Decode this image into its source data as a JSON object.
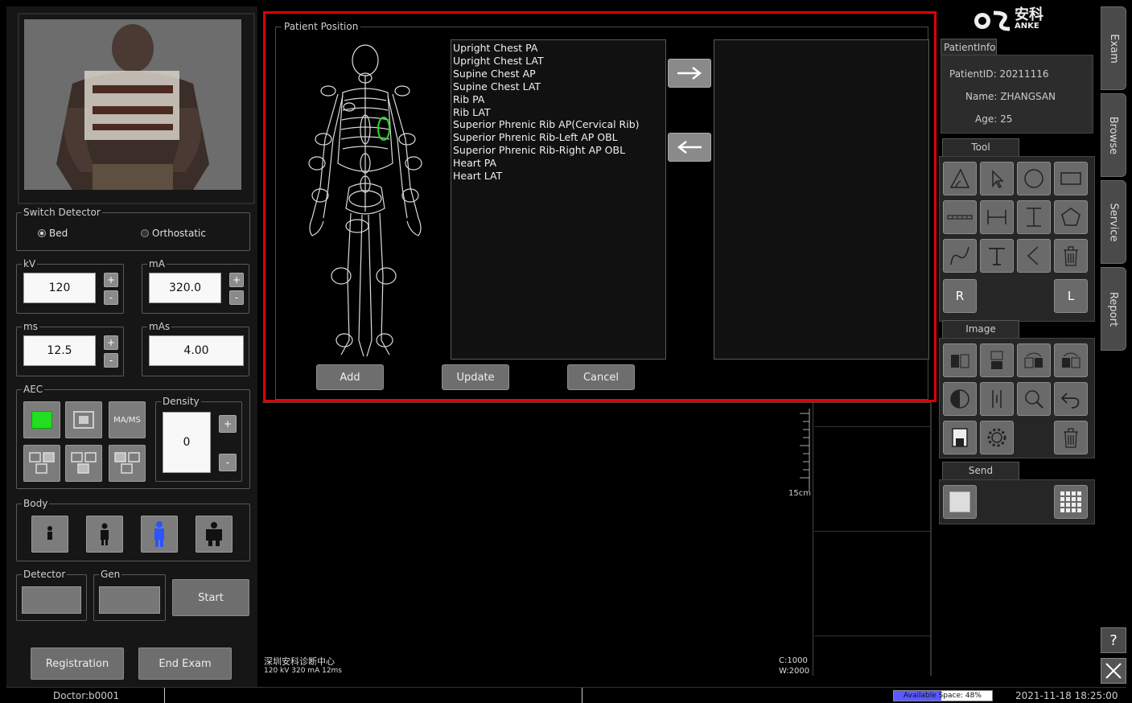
{
  "left": {
    "switch_detector": {
      "legend": "Switch Detector",
      "options": [
        "Bed",
        "Orthostatic"
      ],
      "selected": "Bed"
    },
    "kv": {
      "label": "kV",
      "value": "120"
    },
    "ma": {
      "label": "mA",
      "value": "320.0"
    },
    "ms": {
      "label": "ms",
      "value": "12.5"
    },
    "mas": {
      "label": "mAs",
      "value": "4.00"
    },
    "aec": {
      "label": "AEC",
      "mams_label": "MA/MS"
    },
    "density": {
      "label": "Density",
      "value": "0"
    },
    "body": {
      "label": "Body"
    },
    "detector": {
      "label": "Detector"
    },
    "gen": {
      "label": "Gen"
    },
    "plus": "+",
    "minus": "-",
    "start_label": "Start",
    "registration_label": "Registration",
    "end_exam_label": "End Exam"
  },
  "dialog": {
    "title": "Patient Position",
    "positions": [
      "Upright Chest PA",
      "Upright Chest LAT",
      "Supine Chest AP",
      "Supine Chest LAT",
      "Rib PA",
      "Rib LAT",
      "Superior Phrenic Rib AP(Cervical Rib)",
      "Superior Phrenic Rib-Left AP OBL",
      "Superior Phrenic Rib-Right AP OBL",
      "Heart PA",
      "Heart LAT"
    ],
    "add_label": "Add",
    "update_label": "Update",
    "cancel_label": "Cancel"
  },
  "viewer": {
    "scale_label": "15cm",
    "hospital": "深圳安科诊断中心",
    "exposure": "120 kV 320 mA 12ms",
    "c": "C:1000",
    "w": "W:2000"
  },
  "right": {
    "brand_cn": "安科",
    "brand_en": "ANKE",
    "patient_tab": "PatientInfo",
    "patient_id_label": "PatientID:",
    "patient_id": "20211116",
    "name_label": "Name:",
    "name": "ZHANGSAN",
    "age_label": "Age:",
    "age": "25",
    "tool_tab": "Tool",
    "image_tab": "Image",
    "send_tab": "Send",
    "r_label": "R",
    "l_label": "L"
  },
  "side_tabs": [
    "Exam",
    "Browse",
    "Service",
    "Report"
  ],
  "help_label": "?",
  "status": {
    "doctor": "Doctor:b0001",
    "available_space": "Available Space: 48%",
    "available_space_percent": 48,
    "datetime": "2021-11-18 18:25:00"
  },
  "colors": {
    "dialog_border": "#e00000",
    "aec_active": "#22dd22",
    "body_selected": "#2a55ff",
    "space_bar": "#5a5aff"
  }
}
